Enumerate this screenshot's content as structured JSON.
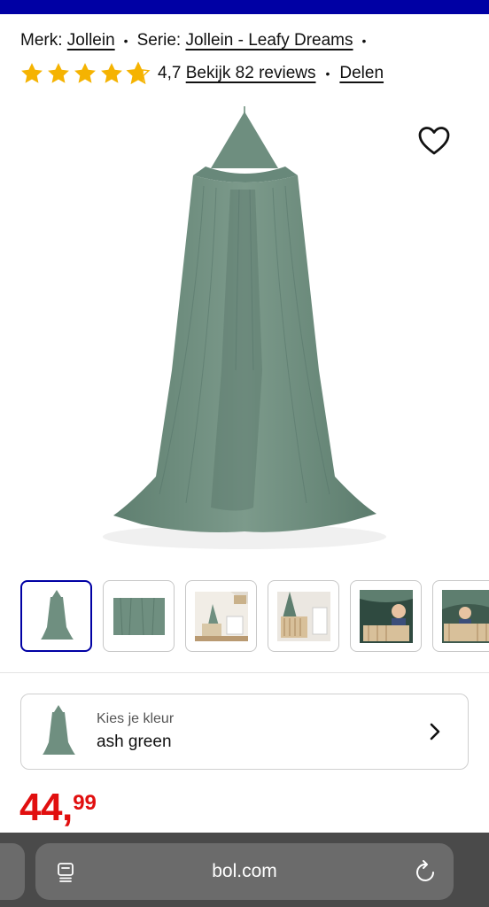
{
  "product": {
    "brand_label": "Merk:",
    "brand": "Jollein",
    "series_label": "Serie:",
    "series": "Jollein - Leafy Dreams",
    "rating": "4,7",
    "rating_value": 4.7,
    "rating_max": 5,
    "reviews_link": "Bekijk 82 reviews",
    "share_link": "Delen"
  },
  "gallery": {
    "main_image_icon": "green-bed-canopy-image",
    "thumbnails": [
      "canopy-full",
      "fabric-detail",
      "nursery-room",
      "crib-with-canopy",
      "child-under-canopy",
      "child-in-crib"
    ],
    "active_index": 0
  },
  "color_selector": {
    "label": "Kies je kleur",
    "value": "ash green"
  },
  "price": {
    "whole": "44",
    "comma": ",",
    "decimals": "99",
    "color": "#e10f0f"
  },
  "browser": {
    "url": "bol.com"
  },
  "colors": {
    "brand_blue": "#0000a4",
    "star": "#f5b301",
    "canopy": "#6f8f80"
  }
}
